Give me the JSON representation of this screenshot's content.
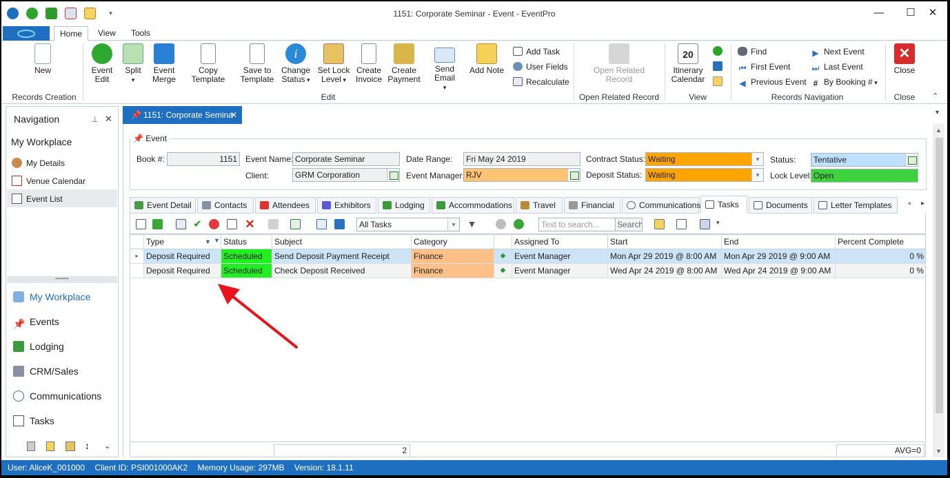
{
  "window": {
    "title": "1151: Corporate Seminar - Event - EventPro"
  },
  "ribbon": {
    "tabs": [
      "Home",
      "View",
      "Tools"
    ],
    "buttons": {
      "new": "New",
      "event_edit_1": "Event",
      "event_edit_2": "Edit",
      "split": "Split",
      "event_merge_1": "Event",
      "event_merge_2": "Merge",
      "copy_template": "Copy Template",
      "save_template_1": "Save to",
      "save_template_2": "Template",
      "change_status_1": "Change",
      "change_status_2": "Status",
      "set_lock_1": "Set Lock",
      "set_lock_2": "Level",
      "create_invoice_1": "Create",
      "create_invoice_2": "Invoice",
      "create_payment_1": "Create",
      "create_payment_2": "Payment",
      "send_email": "Send Email",
      "add_note": "Add Note",
      "add_task": "Add Task",
      "user_fields": "User Fields",
      "recalculate": "Recalculate",
      "open_related_1": "Open Related",
      "open_related_2": "Record",
      "itinerary_1": "Itinerary",
      "itinerary_2": "Calendar",
      "find": "Find",
      "first_event": "First Event",
      "previous_event": "Previous Event",
      "next_event": "Next Event",
      "last_event": "Last Event",
      "by_booking": "By Booking #",
      "close": "Close"
    },
    "groups": {
      "records_creation": "Records Creation",
      "edit": "Edit",
      "open_related": "Open Related Record",
      "view": "View",
      "records_navigation": "Records Navigation",
      "close": "Close"
    }
  },
  "navigation": {
    "title": "Navigation",
    "workplace_title": "My Workplace",
    "items": [
      "My Details",
      "Venue Calendar",
      "Event List"
    ],
    "sections": [
      "My Workplace",
      "Events",
      "Lodging",
      "CRM/Sales",
      "Communications",
      "Tasks"
    ]
  },
  "doc_tab": {
    "label": "1151: Corporate Semina"
  },
  "event": {
    "legend": "Event",
    "book_label": "Book #:",
    "book": "1151",
    "name_label": "Event Name:",
    "name": "Corporate Seminar",
    "client_label": "Client:",
    "client": "GRM Corporation",
    "date_label": "Date Range:",
    "date": "Fri May 24 2019",
    "manager_label": "Event Manager:",
    "manager": "RJV",
    "contract_label": "Contract Status:",
    "contract": "Waiting",
    "deposit_label": "Deposit Status:",
    "deposit": "Waiting",
    "status_label": "Status:",
    "status": "Tentative",
    "lock_label": "Lock Level:",
    "lock": "Open"
  },
  "subtabs": [
    "Event Detail",
    "Contacts",
    "Attendees",
    "Exhibitors",
    "Lodging",
    "Accommodations",
    "Travel",
    "Financial",
    "Communications",
    "Tasks",
    "Documents",
    "Letter Templates"
  ],
  "toolbar": {
    "filter": "All Tasks",
    "search_placeholder": "Text to search...",
    "search_button": "Search"
  },
  "grid": {
    "columns": [
      "Type",
      "Status",
      "Subject",
      "Category",
      "Assigned To",
      "Start",
      "End",
      "Percent Complete"
    ],
    "rows": [
      {
        "type": "Deposit Required",
        "status": "Scheduled",
        "subject": "Send Deposit Payment Receipt",
        "category": "Finance",
        "assigned": "Event Manager",
        "start": "Mon Apr 29 2019 @ 8:00 AM",
        "end": "Mon Apr 29 2019 @ 9:00 AM",
        "percent": "0 %"
      },
      {
        "type": "Deposit Required",
        "status": "Scheduled",
        "subject": "Check Deposit Received",
        "category": "Finance",
        "assigned": "Event Manager",
        "start": "Wed Apr 24 2019 @ 8:00 AM",
        "end": "Wed Apr 24 2019 @ 9:00 AM",
        "percent": "0 %"
      }
    ],
    "footer_count": "2",
    "footer_avg": "AVG=0"
  },
  "statusbar": {
    "user": "User: AliceK_001000",
    "client": "Client ID: PSI001000AK2",
    "memory": "Memory Usage: 297MB",
    "version": "Version: 18.1.11"
  },
  "colors": {
    "accent": "#1f6fc0",
    "waiting": "#ffa500",
    "tentative": "#bfe0ff",
    "open": "#3fd13f",
    "scheduled": "#22ee22",
    "finance": "#ffc188",
    "selected_row": "#cde3f6",
    "arrow": "#e8141c"
  }
}
